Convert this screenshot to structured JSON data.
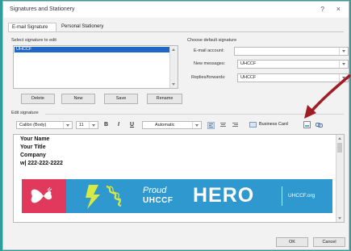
{
  "window": {
    "title": "Signatures and Stationery",
    "help_glyph": "?",
    "close_glyph": "×"
  },
  "tabs": [
    {
      "label": "E-mail Signature"
    },
    {
      "label": "Personal Stationery"
    }
  ],
  "select_signature": {
    "label": "Select signature to edit",
    "items": [
      "UHCCF"
    ]
  },
  "signature_buttons": {
    "delete": "Delete",
    "new": "New",
    "save": "Save",
    "rename": "Rename"
  },
  "default_signature": {
    "label": "Choose default signature",
    "email_account_label": "E-mail account:",
    "email_account_value": "",
    "new_messages_label": "New messages:",
    "new_messages_value": "UHCCF",
    "replies_label": "Replies/forwards:",
    "replies_value": "UHCCF"
  },
  "edit_signature": {
    "label": "Edit signature"
  },
  "toolbar": {
    "font": "Calibri (Body)",
    "size": "11",
    "bold": "B",
    "italic": "I",
    "underline": "U",
    "color": "Automatic",
    "business_card": "Business Card"
  },
  "signature_lines": [
    "Your Name",
    "Your Title",
    "Company",
    "w| 222-222-2222"
  ],
  "banner": {
    "proud": "Proud",
    "uhccf": "UHCCF",
    "hero": "HERO",
    "url": "UHCCF.org"
  },
  "footer": {
    "ok": "OK",
    "cancel": "Cancel"
  },
  "colors": {
    "teal_bg": "#2f9d9b",
    "banner_blue": "#2f98cf",
    "banner_red": "#e0395b",
    "arrow": "#a11d24",
    "selection": "#1e66c7"
  }
}
